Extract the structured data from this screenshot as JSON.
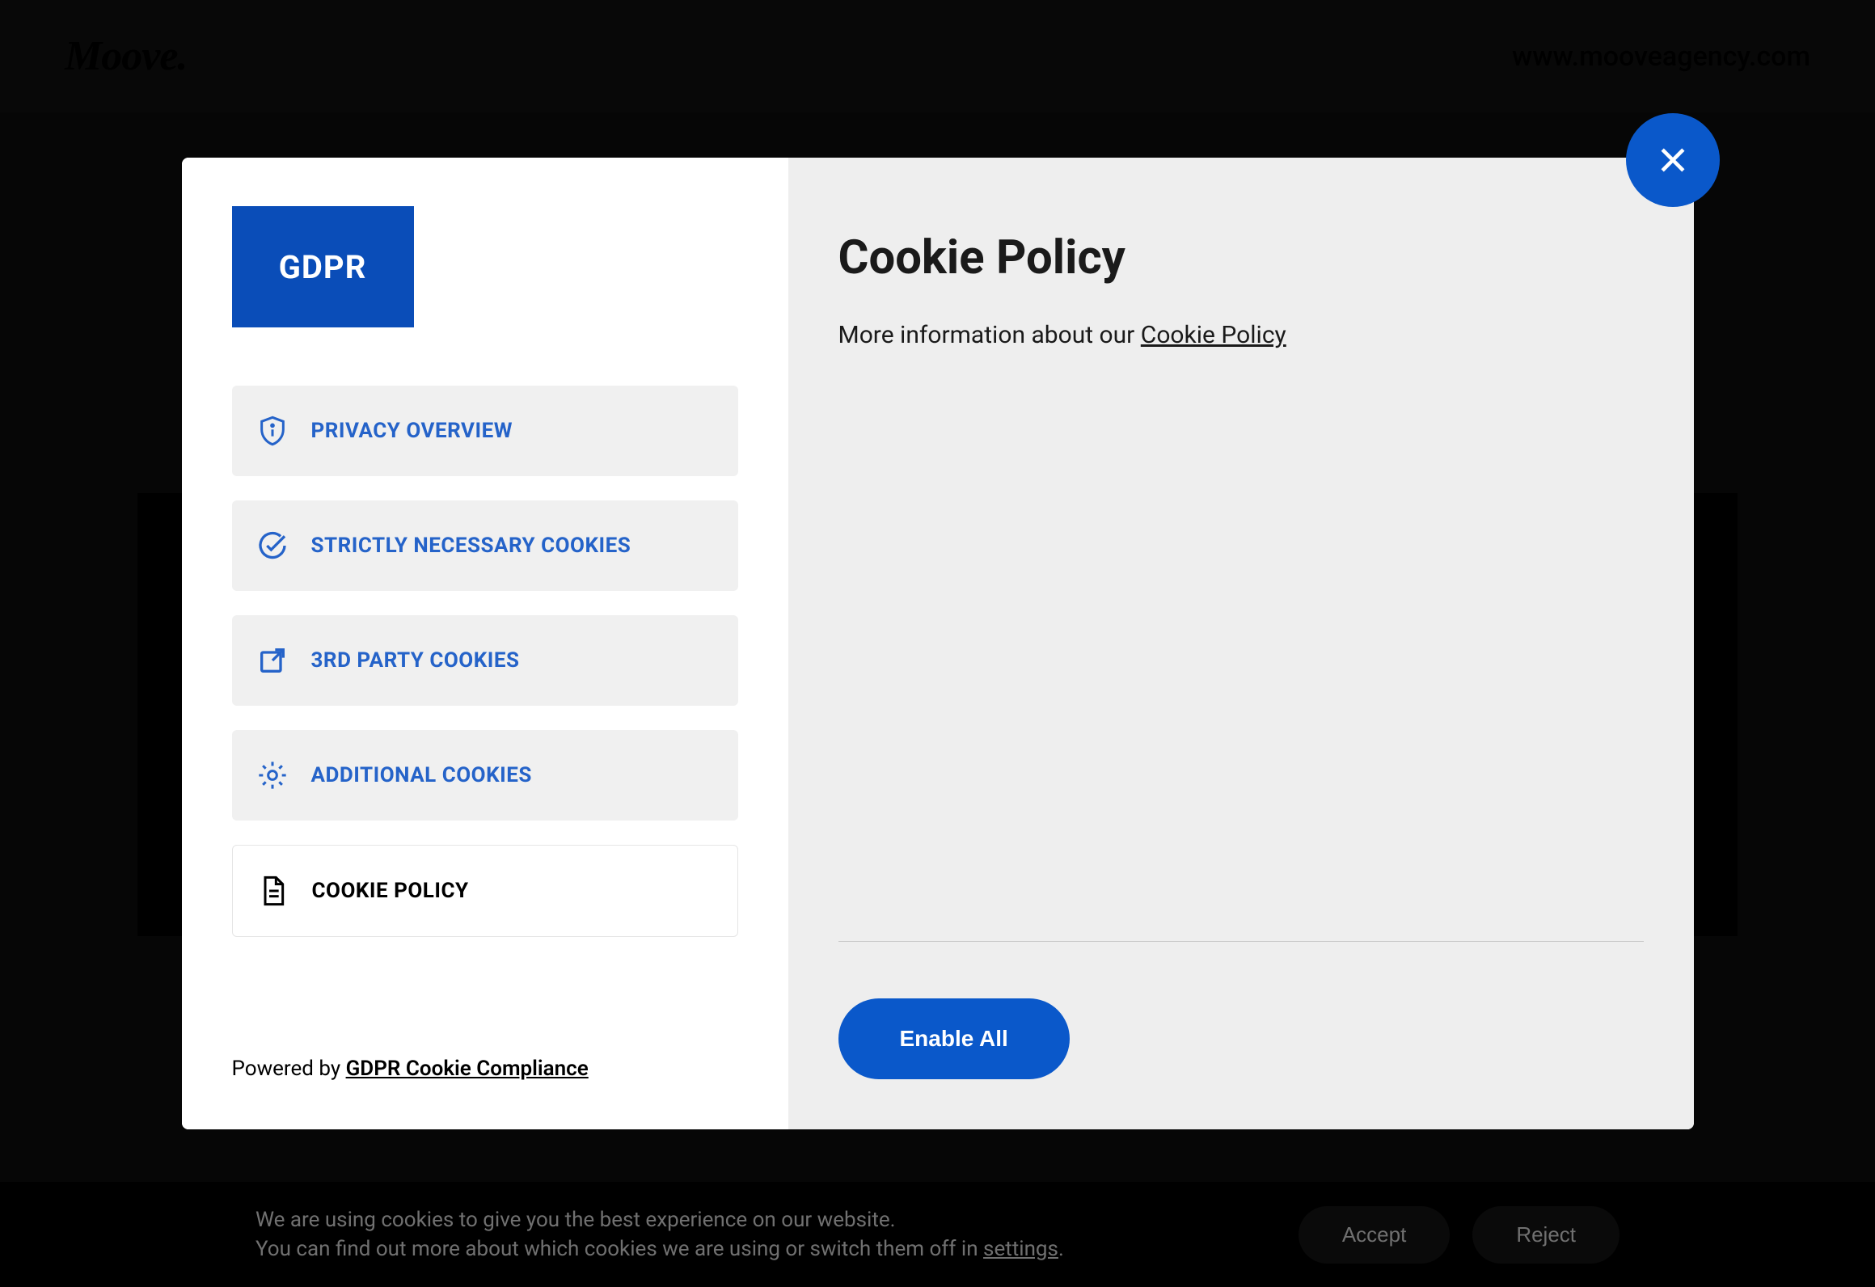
{
  "header": {
    "logo": "Moove.",
    "url": "www.mooveagency.com"
  },
  "modal": {
    "gdpr_badge": "GDPR",
    "nav": [
      {
        "label": "PRIVACY OVERVIEW",
        "icon": "shield-info",
        "active": false
      },
      {
        "label": "STRICTLY NECESSARY COOKIES",
        "icon": "check-circle",
        "active": false
      },
      {
        "label": "3RD PARTY COOKIES",
        "icon": "external-link",
        "active": false
      },
      {
        "label": "ADDITIONAL COOKIES",
        "icon": "gear",
        "active": false
      },
      {
        "label": "COOKIE POLICY",
        "icon": "file-text",
        "active": true
      }
    ],
    "powered_prefix": "Powered by ",
    "powered_link": "GDPR Cookie Compliance",
    "content": {
      "title": "Cookie Policy",
      "text_prefix": "More information about our ",
      "text_link": "Cookie Policy"
    },
    "enable_button": "Enable All"
  },
  "cookie_bar": {
    "line1": "We are using cookies to give you the best experience on our website.",
    "line2_prefix": "You can find out more about which cookies we are using or switch them off in ",
    "line2_link": "settings",
    "line2_suffix": ".",
    "accept": "Accept",
    "reject": "Reject"
  }
}
